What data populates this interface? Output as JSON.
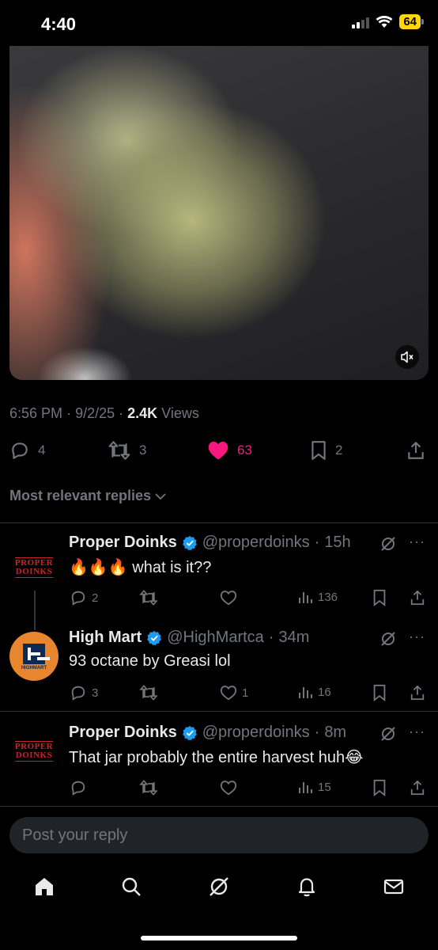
{
  "status_bar": {
    "time": "4:40",
    "battery": "64"
  },
  "tweet": {
    "time": "6:56 PM",
    "date": "9/2/25",
    "views_count": "2.4K",
    "views_label": "Views",
    "actions": {
      "replies": "4",
      "reposts": "3",
      "likes": "63",
      "bookmarks": "2"
    }
  },
  "replies_sort_label": "Most relevant replies",
  "replies": [
    {
      "name": "Proper Doinks",
      "handle": "@properdoinks",
      "age": "15h",
      "text": "🔥🔥🔥 what is it??",
      "replies": "2",
      "likes": "",
      "views": "136"
    },
    {
      "name": "High Mart",
      "handle": "@HighMartca",
      "age": "34m",
      "text": "93 octane by Greasi lol",
      "replies": "3",
      "likes": "1",
      "views": "16"
    },
    {
      "name": "Proper Doinks",
      "handle": "@properdoinks",
      "age": "8m",
      "text": "That jar probably the entire harvest huh😂",
      "replies": "",
      "likes": "",
      "views": "15"
    }
  ],
  "avatars": {
    "proper_line1": "PROPER",
    "proper_line2": "DOINKS",
    "highmart_label": "HIGHMART"
  },
  "composer": {
    "placeholder": "Post your reply"
  },
  "colors": {
    "accent_like": "#f91880",
    "verified": "#1d9bf0",
    "muted_text": "#71767b"
  },
  "icons": [
    "mute-icon",
    "reply-icon",
    "repost-icon",
    "heart-icon",
    "bookmark-icon",
    "share-icon",
    "grok-icon",
    "more-icon",
    "views-icon",
    "home-icon",
    "search-icon",
    "notifications-icon",
    "messages-icon"
  ]
}
